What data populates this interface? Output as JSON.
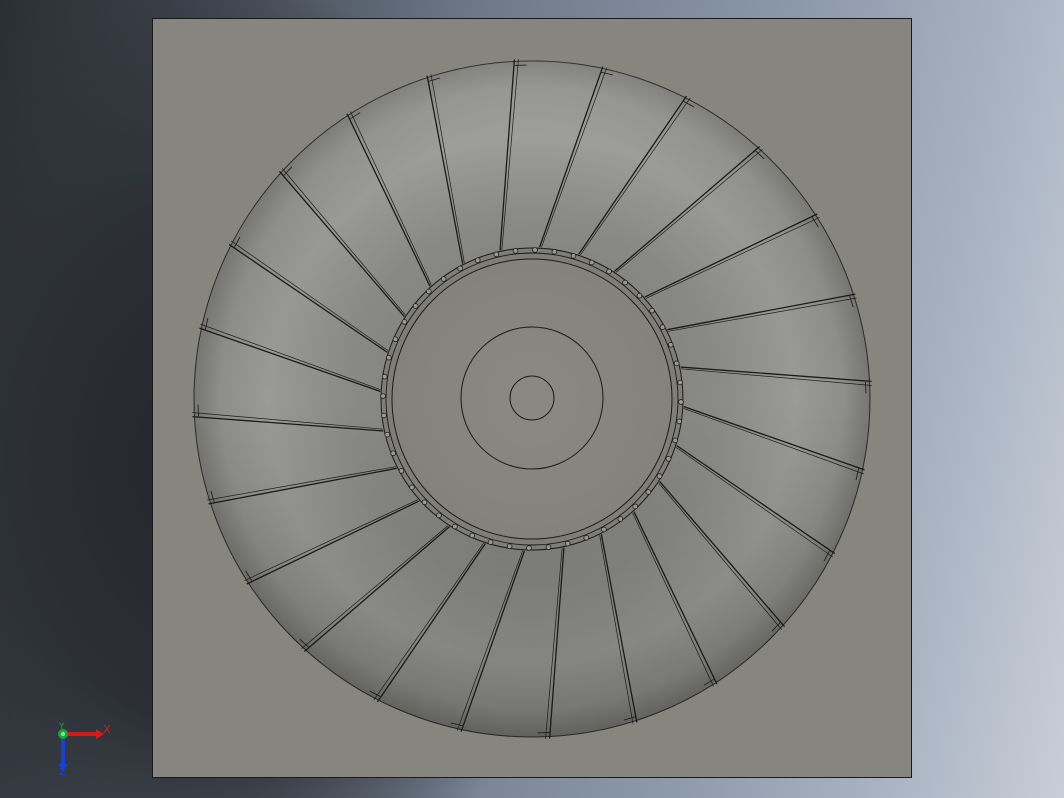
{
  "view": {
    "name": "graphics-area",
    "background_colors": [
      "#2b2f35",
      "#6e7988",
      "#c8ced8"
    ],
    "part_color": "#858580",
    "edge_color": "#1a1a1a"
  },
  "model": {
    "blade_count": 24,
    "hub_bolt_count": 48
  },
  "triad": {
    "x_label": "X",
    "y_label": "Y",
    "z_label": "Z",
    "x_color": "#d21c1c",
    "y_color": "#19a23a",
    "z_color": "#1b3fd0"
  }
}
